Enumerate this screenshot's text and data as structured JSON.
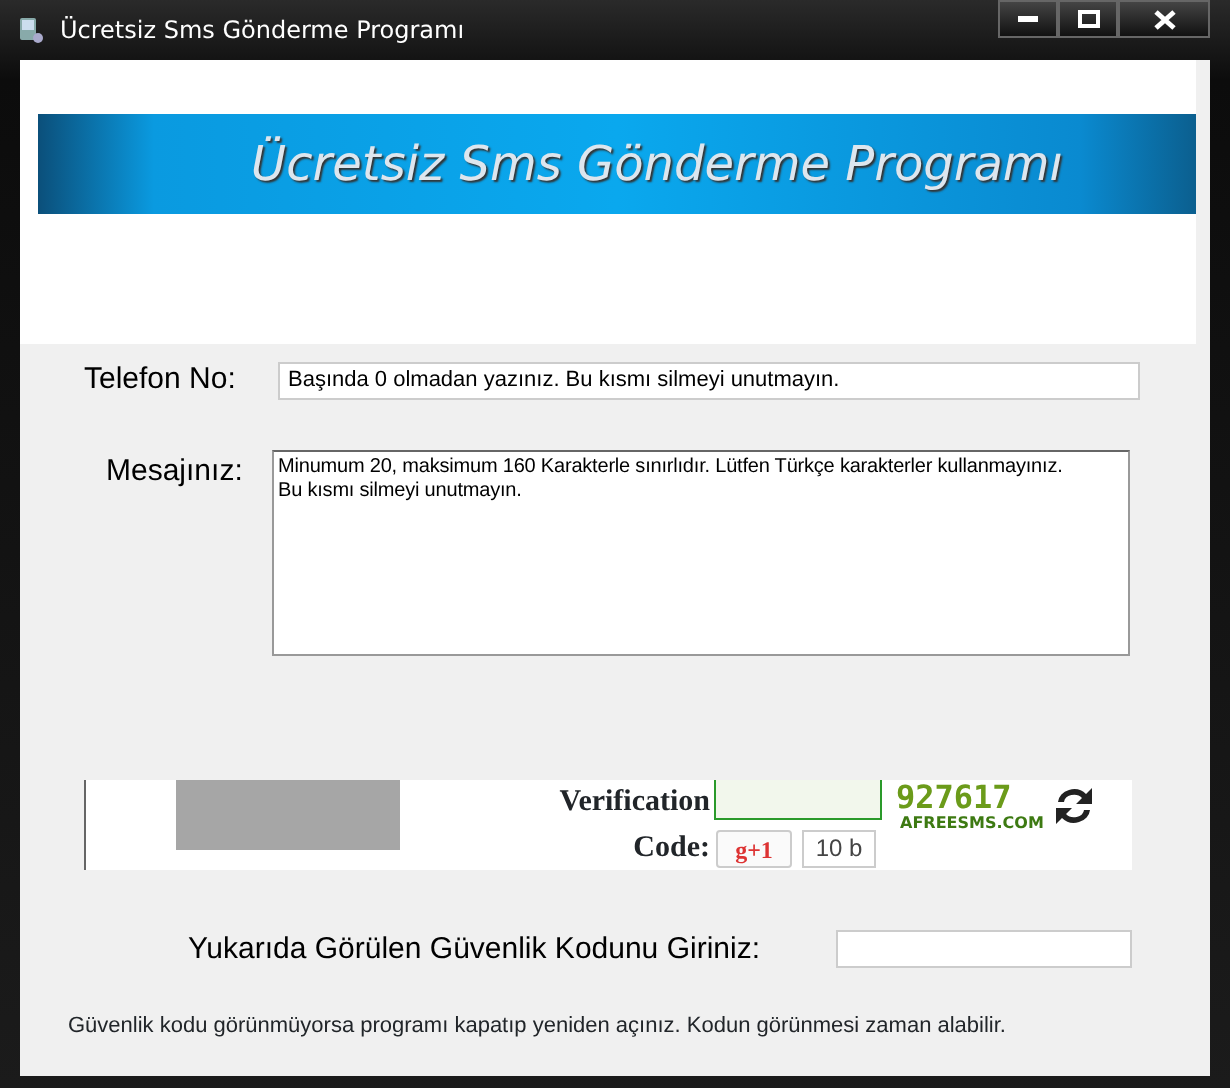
{
  "window": {
    "title": "Ücretsiz Sms Gönderme Programı"
  },
  "banner": {
    "title": "Ücretsiz Sms Gönderme Programı"
  },
  "phone": {
    "label": "Telefon No:",
    "value": "Başında 0 olmadan yazınız. Bu kısmı silmeyi unutmayın."
  },
  "message": {
    "label": "Mesajınız:",
    "value": "Minumum 20, maksimum 160 Karakterle sınırlıdır. Lütfen Türkçe karakterler kullanmayınız.\nBu kısmı silmeyi unutmayın."
  },
  "captcha": {
    "label": "Verification Code:",
    "code": "927617",
    "site": "AFREESMS.COM",
    "plus_button": "g+1",
    "plus_count": "10 b"
  },
  "security": {
    "label": "Yukarıda Görülen Güvenlik Kodunu Giriniz:"
  },
  "note": "Güvenlik kodu görünmüyorsa programı kapatıp yeniden açınız. Kodun görünmesi zaman alabilir."
}
